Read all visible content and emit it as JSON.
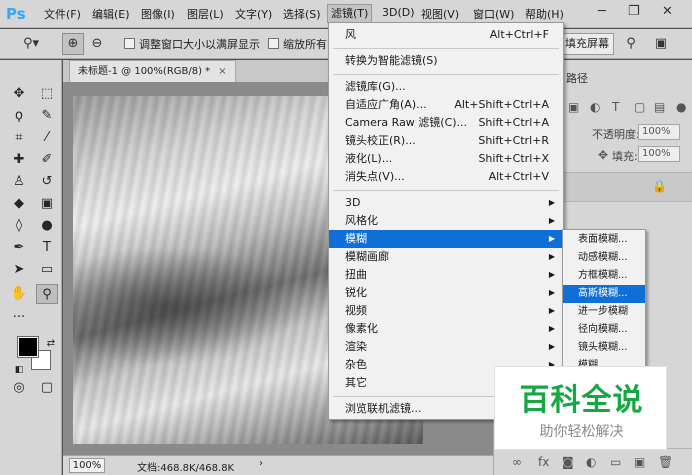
{
  "app": {
    "logo": "Ps"
  },
  "menubar": {
    "items": [
      "文件(F)",
      "编辑(E)",
      "图像(I)",
      "图层(L)",
      "文字(Y)",
      "选择(S)",
      "滤镜(T)",
      "3D(D)",
      "视图(V)",
      "窗口(W)",
      "帮助(H)"
    ],
    "active": "滤镜(T)"
  },
  "options": {
    "zoom_tool_icon": "magnifier-icon",
    "resize_label": "调整窗口大小以满屏显示",
    "zoom_all_label": "缩放所有",
    "fill_screen_label": "填充屏幕"
  },
  "document": {
    "tab_title": "未标题-1 @ 100%(RGB/8) *",
    "zoom": "100%",
    "info": "文档:468.8K/468.8K"
  },
  "filter_menu": {
    "last_filter": {
      "label": "风",
      "shortcut": "Alt+Ctrl+F"
    },
    "smart": {
      "label": "转换为智能滤镜(S)"
    },
    "group1": [
      {
        "label": "滤镜库(G)...",
        "shortcut": ""
      },
      {
        "label": "自适应广角(A)...",
        "shortcut": "Alt+Shift+Ctrl+A"
      },
      {
        "label": "Camera Raw 滤镜(C)...",
        "shortcut": "Shift+Ctrl+A"
      },
      {
        "label": "镜头校正(R)...",
        "shortcut": "Shift+Ctrl+R"
      },
      {
        "label": "液化(L)...",
        "shortcut": "Shift+Ctrl+X"
      },
      {
        "label": "消失点(V)...",
        "shortcut": "Alt+Ctrl+V"
      }
    ],
    "group2": [
      {
        "label": "3D",
        "highlighted": false
      },
      {
        "label": "风格化",
        "highlighted": false
      },
      {
        "label": "模糊",
        "highlighted": true
      },
      {
        "label": "模糊画廊",
        "highlighted": false
      },
      {
        "label": "扭曲",
        "highlighted": false
      },
      {
        "label": "锐化",
        "highlighted": false
      },
      {
        "label": "视频",
        "highlighted": false
      },
      {
        "label": "像素化",
        "highlighted": false
      },
      {
        "label": "渲染",
        "highlighted": false
      },
      {
        "label": "杂色",
        "highlighted": false
      },
      {
        "label": "其它",
        "highlighted": false
      }
    ],
    "browse": {
      "label": "浏览联机滤镜..."
    }
  },
  "blur_submenu": {
    "items": [
      {
        "label": "表面模糊...",
        "highlighted": false
      },
      {
        "label": "动感模糊...",
        "highlighted": false
      },
      {
        "label": "方框模糊...",
        "highlighted": false
      },
      {
        "label": "高斯模糊...",
        "highlighted": true
      },
      {
        "label": "进一步模糊",
        "highlighted": false
      },
      {
        "label": "径向模糊...",
        "highlighted": false
      },
      {
        "label": "镜头模糊...",
        "highlighted": false
      },
      {
        "label": "模糊",
        "highlighted": false
      }
    ]
  },
  "layers_panel": {
    "tab_label": "路径",
    "opacity_label": "不透明度:",
    "opacity_value": "100%",
    "fill_label": "填充:",
    "fill_value": "100%"
  },
  "watermark": {
    "main": "百科全说",
    "sub": "助你轻松解决",
    "color": "#17a844"
  }
}
